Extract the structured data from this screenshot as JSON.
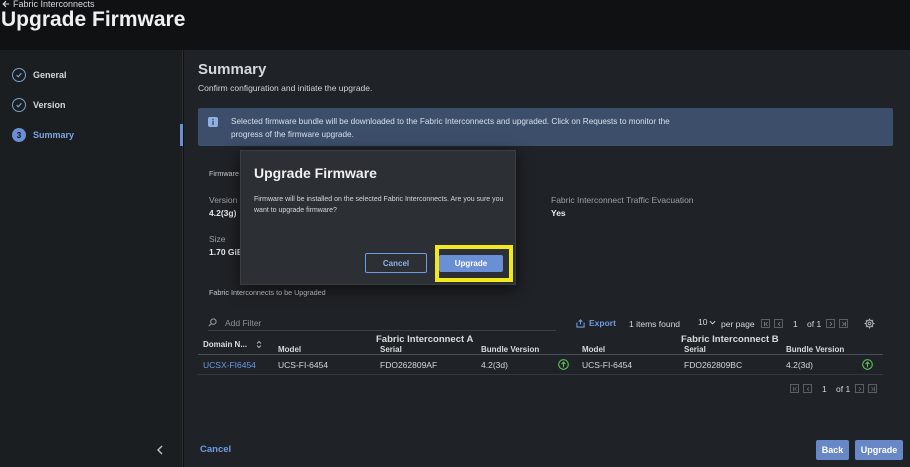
{
  "header": {
    "back_label": "Fabric Interconnects",
    "title": "Upgrade Firmware"
  },
  "sidebar": {
    "steps": [
      {
        "label": "General",
        "state": "done"
      },
      {
        "label": "Version",
        "state": "done"
      },
      {
        "number": "3",
        "label": "Summary",
        "state": "active"
      }
    ]
  },
  "summary": {
    "title": "Summary",
    "subtitle": "Confirm configuration and initiate the upgrade.",
    "banner": "Selected firmware bundle will be downloaded to the Fabric Interconnects and upgraded. Click on Requests to monitor the progress of the firmware upgrade.",
    "firmware_label": "Firmware",
    "version_label": "Version",
    "version_value": "4.2(3g)",
    "size_label": "Size",
    "size_value": "1.70 GiB",
    "evac_label": "Fabric Interconnect Traffic Evacuation",
    "evac_value": "Yes",
    "fis_label": "Fabric Interconnects to be Upgraded"
  },
  "table_toolbar": {
    "filter_placeholder": "Add Filter",
    "export_label": "Export",
    "items_found": "1 items found",
    "per_page_value": "10",
    "per_page_label": "per page",
    "page_current": "1",
    "page_total": "of 1"
  },
  "table": {
    "group_a": "Fabric Interconnect A",
    "group_b": "Fabric Interconnect B",
    "columns": {
      "domain": "Domain N...",
      "model_a": "Model",
      "serial_a": "Serial",
      "bundle_a": "Bundle Version",
      "model_b": "Model",
      "serial_b": "Serial",
      "bundle_b": "Bundle Version"
    },
    "rows": [
      {
        "domain": "UCSX-FI6454",
        "model_a": "UCS-FI-6454",
        "serial_a": "FDO262809AF",
        "bundle_a": "4.2(3d)",
        "model_b": "UCS-FI-6454",
        "serial_b": "FDO262809BC",
        "bundle_b": "4.2(3d)"
      }
    ]
  },
  "footer": {
    "cancel_label": "Cancel",
    "back_label": "Back",
    "upgrade_label": "Upgrade"
  },
  "modal": {
    "title": "Upgrade Firmware",
    "body": "Firmware will be installed on the selected Fabric Interconnects. Are you sure you want to upgrade firmware?",
    "cancel_label": "Cancel",
    "upgrade_label": "Upgrade",
    "highlight_color": "#f2e81e"
  },
  "colors": {
    "accent": "#6b8fd4",
    "link": "#6e9be6",
    "success": "#5fb85a"
  }
}
